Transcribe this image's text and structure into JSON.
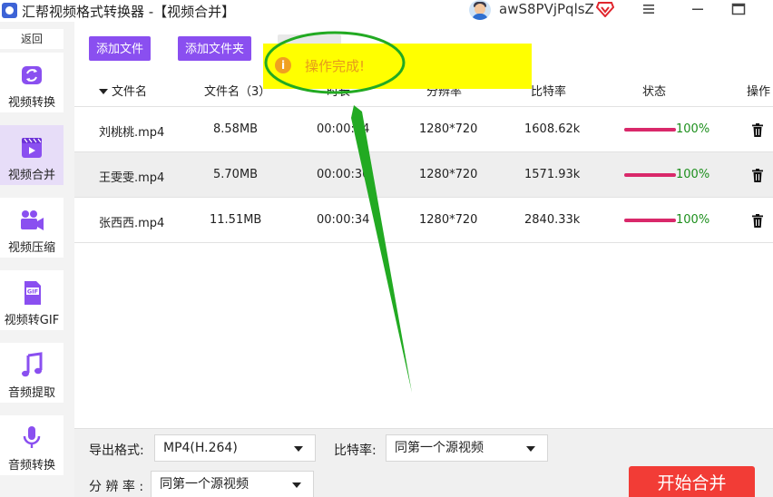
{
  "app": {
    "title": "汇帮视频格式转换器 -【视频合并】",
    "user_name": "awS8PVjPqlsZ"
  },
  "sidebar": {
    "back_label": "返回",
    "items": [
      {
        "label": "视频转换",
        "icon": "video-convert-icon",
        "active": false
      },
      {
        "label": "视频合并",
        "icon": "video-merge-icon",
        "active": true
      },
      {
        "label": "视频压缩",
        "icon": "video-compress-icon",
        "active": false
      },
      {
        "label": "视频转GIF",
        "icon": "gif-icon",
        "active": false
      },
      {
        "label": "音频提取",
        "icon": "music-note-icon",
        "active": false
      },
      {
        "label": "音频转换",
        "icon": "microphone-icon",
        "active": false
      }
    ]
  },
  "toolbar": {
    "add_file_label": "添加文件",
    "add_folder_label": "添加文件夹"
  },
  "table": {
    "headers": {
      "filename": "文件名",
      "count": "文件名（3）",
      "duration": "时长",
      "resolution": "分辨率",
      "bitrate": "比特率",
      "status": "状态",
      "action": "操作"
    },
    "rows": [
      {
        "name": "刘桃桃.mp4",
        "size": "8.58MB",
        "duration": "00:00:44",
        "resolution": "1280*720",
        "bitrate": "1608.62k",
        "progress": 100,
        "progress_text": "100%"
      },
      {
        "name": "王雯雯.mp4",
        "size": "5.70MB",
        "duration": "00:00:30",
        "resolution": "1280*720",
        "bitrate": "1571.93k",
        "progress": 100,
        "progress_text": "100%"
      },
      {
        "name": "张西西.mp4",
        "size": "11.51MB",
        "duration": "00:00:34",
        "resolution": "1280*720",
        "bitrate": "2840.33k",
        "progress": 100,
        "progress_text": "100%"
      }
    ]
  },
  "toast": {
    "message": "操作完成!"
  },
  "settings": {
    "format_label": "导出格式:",
    "format_value": "MP4(H.264)",
    "bitrate_label": "比特率:",
    "bitrate_value": "同第一个源视频",
    "resolution_label": "分 辨 率 :",
    "resolution_value": "同第一个源视频"
  },
  "start_button_label": "开始合并",
  "colors": {
    "accent": "#8a4ff0",
    "progress": "#d9286a",
    "success_text": "#1d8f1d",
    "start_button": "#f23c36",
    "toast_bg": "#ffff00",
    "annotation": "#22aa22"
  }
}
